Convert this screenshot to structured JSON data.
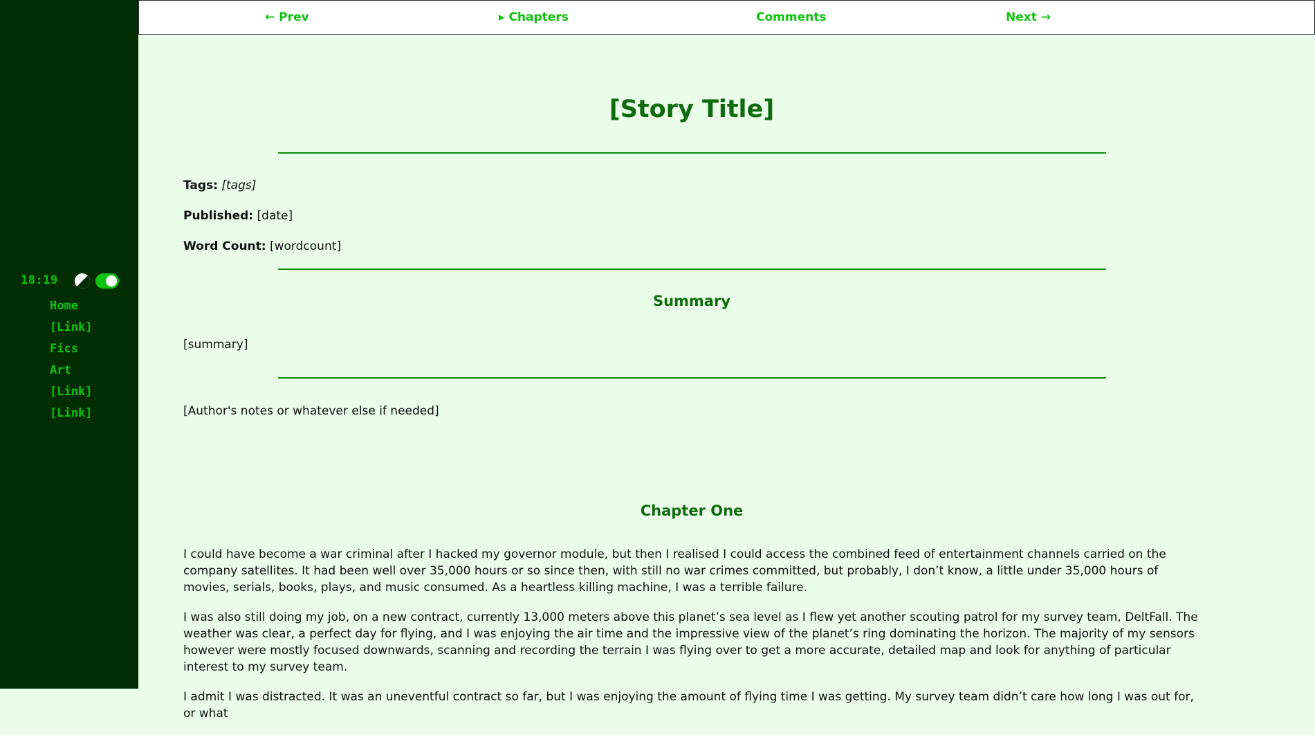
{
  "sidebar": {
    "clock": "18:19",
    "theme_icon": "contrast-icon",
    "toggle_icon": "toggle-switch-icon",
    "nav": [
      {
        "label": "Home"
      },
      {
        "label": "[Link]"
      },
      {
        "label": "Fics"
      },
      {
        "label": "Art"
      },
      {
        "label": "[Link]"
      },
      {
        "label": "[Link]"
      }
    ]
  },
  "topnav": {
    "prev": "← Prev",
    "chapters": "▸ Chapters",
    "comments": "Comments",
    "next": "Next →"
  },
  "story": {
    "title": "[Story Title]",
    "tags_label": "Tags:",
    "tags_value": "[tags]",
    "published_label": "Published:",
    "published_value": "[date]",
    "wordcount_label": "Word Count:",
    "wordcount_value": "[wordcount]",
    "summary_heading": "Summary",
    "summary_text": "[summary]",
    "author_notes": "[Author's notes or whatever else if needed]",
    "chapter_heading": "Chapter One",
    "paragraphs": [
      "I could have become a war criminal after I hacked my governor module, but then I realised I could access the combined feed of entertainment channels carried on the company satellites. It had been well over 35,000 hours or so since then, with still no war crimes committed, but probably, I don’t know, a little under 35,000 hours of movies, serials, books, plays, and music consumed. As a heartless killing machine, I was a terrible failure.",
      "I was also still doing my job, on a new contract, currently 13,000 meters above this planet’s sea level as I flew yet another scouting patrol for my survey team, DeltFall. The weather was clear, a perfect day for flying, and I was enjoying the air time and the impressive view of the planet’s ring dominating the horizon. The majority of my sensors however were mostly focused downwards, scanning and recording the terrain I was flying over to get a more accurate, detailed map and look for anything of particular interest to my survey team.",
      "I admit I was distracted. It was an uneventful contract so far, but I was enjoying the amount of flying time I was getting. My survey team didn’t care how long I was out for, or what"
    ]
  },
  "colors": {
    "sidebar_bg": "#032e04",
    "accent_green": "#0ec30e",
    "heading_green": "#0d6b0d",
    "page_bg": "#eafde9"
  }
}
